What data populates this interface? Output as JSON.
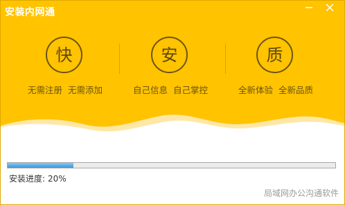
{
  "window": {
    "title": "安装内网通"
  },
  "features": [
    {
      "glyph": "快",
      "icon": "fast-icon",
      "captions": [
        "无需注册",
        "无需添加"
      ]
    },
    {
      "glyph": "安",
      "icon": "secure-icon",
      "captions": [
        "自己信息",
        "自己掌控"
      ]
    },
    {
      "glyph": "质",
      "icon": "quality-icon",
      "captions": [
        "全新体验",
        "全新品质"
      ]
    }
  ],
  "progress": {
    "label": "安装进度:",
    "value_text": "20%",
    "fraction": 0.2
  },
  "footer": {
    "brand": "局域网办公沟通软件"
  },
  "colors": {
    "header": "#ffc300",
    "accent_dark": "#6b5410",
    "progress": "#3a94d8"
  }
}
